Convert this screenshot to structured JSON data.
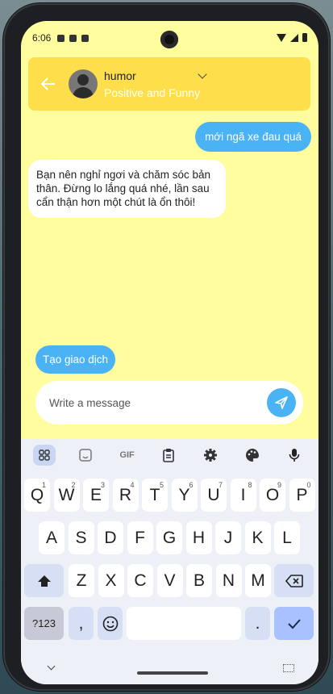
{
  "status_bar": {
    "time": "6:06"
  },
  "header": {
    "bot_name": "humor",
    "bot_description": "Positive and Funny"
  },
  "messages": {
    "user_message": "mới ngã xe đau quá",
    "bot_reply": "Bạn nên nghỉ ngơi và chăm sóc bản thân. Đừng lo lắng quá nhé, lần sau cẩn thận hơn một chút là ổn thôi!"
  },
  "chip": {
    "label": "Tạo giao dịch"
  },
  "composer": {
    "placeholder": "Write a message",
    "value": ""
  },
  "keyboard": {
    "toolbar": [
      "grid-icon",
      "sticker-icon",
      "GIF",
      "clipboard-icon",
      "gear-icon",
      "palette-icon",
      "mic-icon"
    ],
    "gif_label": "GIF",
    "row1": [
      {
        "k": "Q",
        "h": "1"
      },
      {
        "k": "W",
        "h": "2"
      },
      {
        "k": "E",
        "h": "3"
      },
      {
        "k": "R",
        "h": "4"
      },
      {
        "k": "T",
        "h": "5"
      },
      {
        "k": "Y",
        "h": "6"
      },
      {
        "k": "U",
        "h": "7"
      },
      {
        "k": "I",
        "h": "8"
      },
      {
        "k": "O",
        "h": "9"
      },
      {
        "k": "P",
        "h": "0"
      }
    ],
    "row2": [
      "A",
      "S",
      "D",
      "F",
      "G",
      "H",
      "J",
      "K",
      "L"
    ],
    "row3": [
      "Z",
      "X",
      "C",
      "V",
      "B",
      "N",
      "M"
    ],
    "symbols_label": "?123",
    "comma_label": ",",
    "period_label": "."
  },
  "colors": {
    "background": "#fffd9e",
    "header": "#fede4a",
    "accent": "#4ab3f6",
    "keyboard_bg": "#eef0f8"
  }
}
